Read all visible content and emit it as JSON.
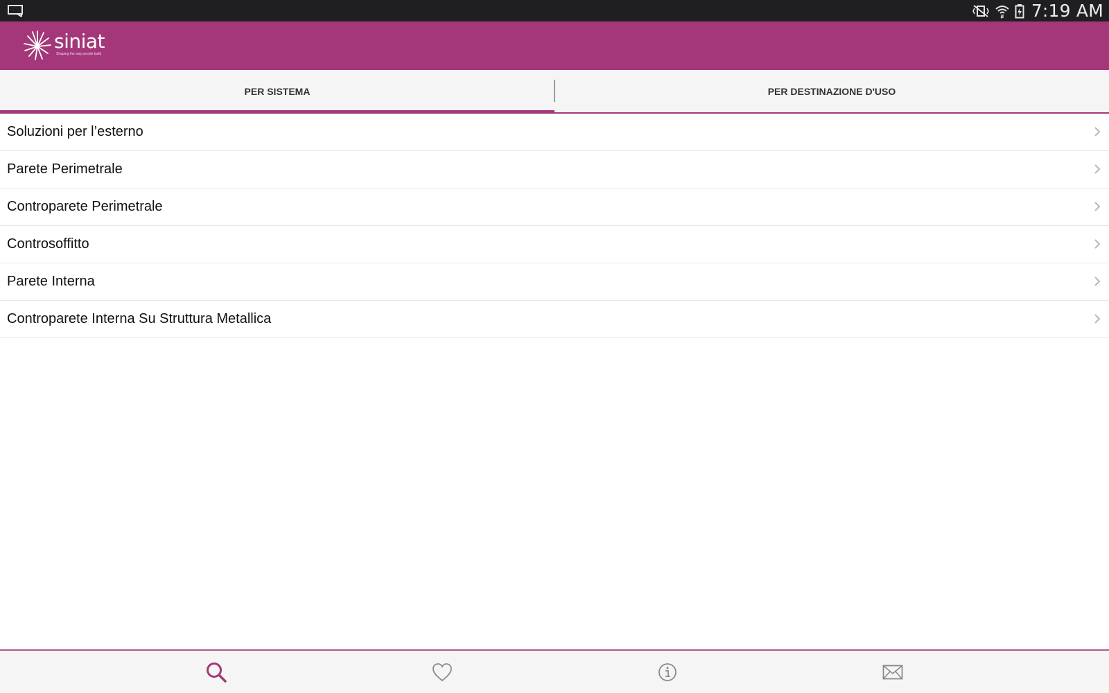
{
  "status_bar": {
    "time": "7:19 AM",
    "icons": [
      "screen-mirror-icon",
      "vibrate-off-icon",
      "wifi-icon",
      "battery-charging-icon"
    ]
  },
  "app_bar": {
    "logo_word": "siniat",
    "logo_tagline": "Shaping the way people build",
    "background_color": "#a4377a"
  },
  "tabs": [
    {
      "label": "PER SISTEMA",
      "selected": true
    },
    {
      "label": "PER DESTINAZIONE D'USO",
      "selected": false
    }
  ],
  "list": {
    "items": [
      {
        "label": "Soluzioni per l’esterno"
      },
      {
        "label": "Parete Perimetrale"
      },
      {
        "label": "Controparete Perimetrale"
      },
      {
        "label": "Controsoffitto"
      },
      {
        "label": "Parete Interna"
      },
      {
        "label": "Controparete Interna Su Struttura Metallica"
      }
    ],
    "item_icon": "chevron-right-icon"
  },
  "bottom_nav": {
    "items": [
      {
        "icon": "search-icon",
        "active": true
      },
      {
        "icon": "heart-icon",
        "active": false
      },
      {
        "icon": "info-icon",
        "active": false
      },
      {
        "icon": "mail-icon",
        "active": false
      }
    ],
    "active_color": "#a4377a",
    "inactive_color": "#8a8a8a"
  }
}
